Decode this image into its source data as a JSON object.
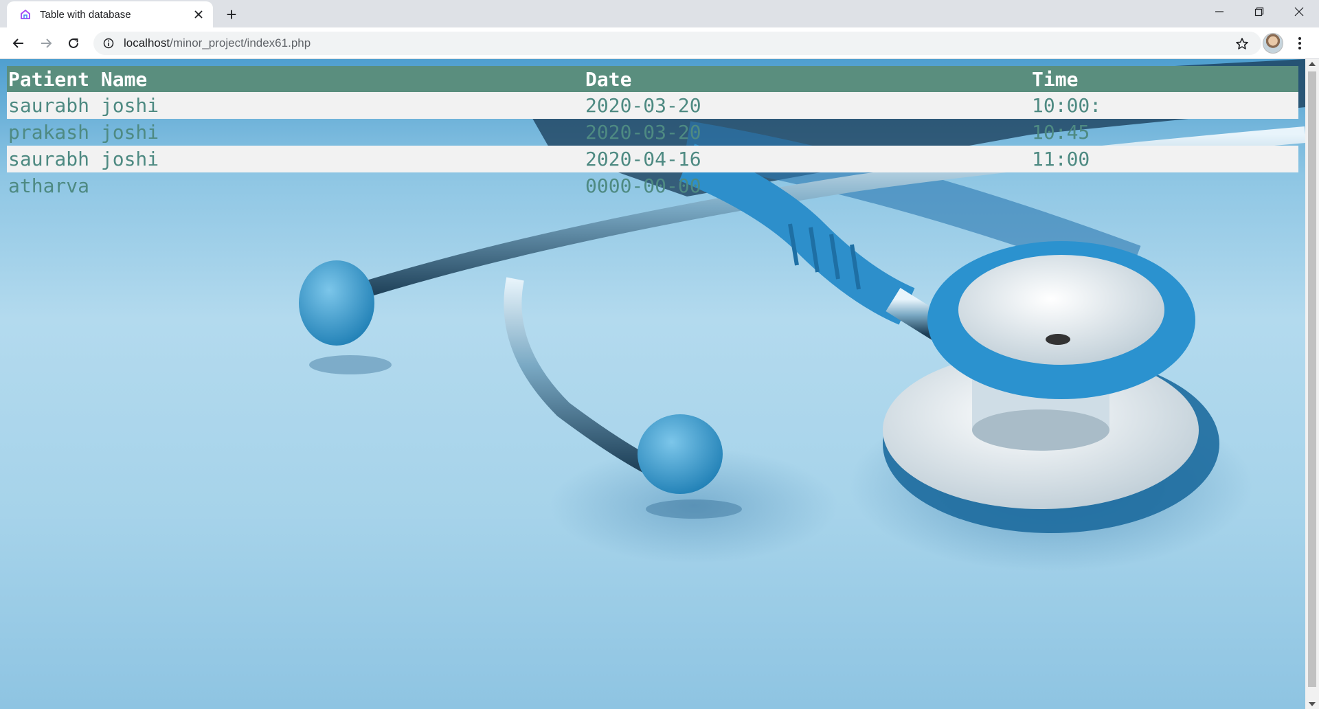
{
  "browser": {
    "tab_title": "Table with database",
    "new_tab_label": "+",
    "url_host": "localhost",
    "url_path": "/minor_project/index61.php"
  },
  "table": {
    "headers": [
      "Patient Name",
      "Date",
      "Time"
    ],
    "rows": [
      [
        "saurabh joshi",
        "2020-03-20",
        "10:00:"
      ],
      [
        "prakash joshi",
        "2020-03-20",
        "10:45"
      ],
      [
        "saurabh joshi",
        "2020-04-16",
        "11:00"
      ],
      [
        "atharva",
        "0000-00-00",
        ""
      ]
    ]
  },
  "colors": {
    "header_bg": "#5a8e7e",
    "cell_text": "#4e8a82",
    "stripe_bg": "#f2f2f2"
  },
  "icons": {
    "favicon": "home-icon",
    "back": "back-arrow-icon",
    "forward": "forward-arrow-icon",
    "reload": "reload-icon",
    "info": "info-icon",
    "bookmark": "star-icon",
    "menu": "menu-dots-icon"
  }
}
